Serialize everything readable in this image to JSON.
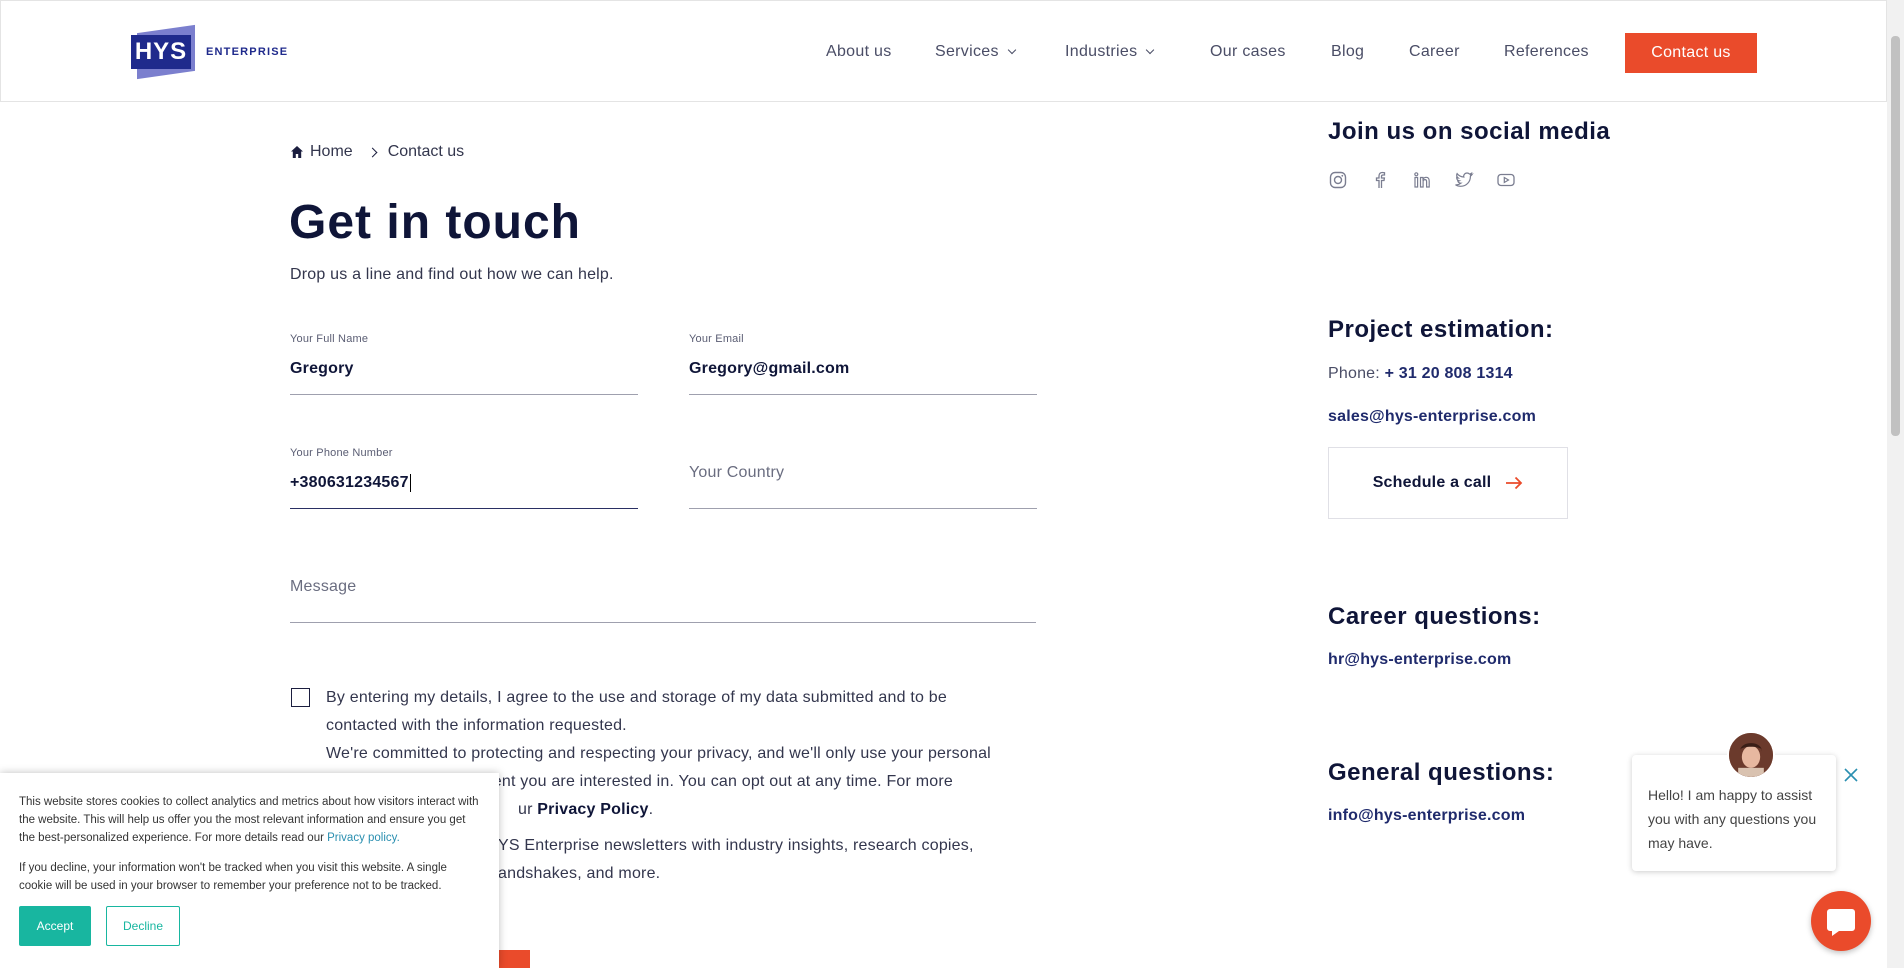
{
  "header": {
    "logo_mark": "HYS",
    "logo_text": "ENTERPRISE",
    "nav": [
      {
        "label": "About us"
      },
      {
        "label": "Services"
      },
      {
        "label": "Industries"
      },
      {
        "label": "Our cases"
      },
      {
        "label": "Blog"
      },
      {
        "label": "Career"
      },
      {
        "label": "References"
      }
    ],
    "cta_label": "Contact us"
  },
  "breadcrumb": {
    "home": "Home",
    "current": "Contact us"
  },
  "main": {
    "title": "Get in touch",
    "subtitle": "Drop us a line and find out how we can help."
  },
  "form": {
    "full_name": {
      "label": "Your Full Name",
      "value": "Gregory"
    },
    "email": {
      "label": "Your Email",
      "value": "Gregory@gmail.com"
    },
    "phone": {
      "label": "Your Phone Number",
      "value": "+380631234567"
    },
    "country": {
      "placeholder": "Your Country"
    },
    "message": {
      "placeholder": "Message"
    },
    "consent_line1": "By entering my details, I agree to the use and storage of my data submitted and to be",
    "consent_line2": "contacted with the information requested.",
    "consent_line3": "We're committed to protecting and respecting your privacy, and we'll only use your personal",
    "consent_line4_visible": "n content you are interested in. You can opt out at any time. For more",
    "consent_line5_visible": "ur",
    "privacy_link": "Privacy Policy",
    "newsletter_line1_visible": "YS Enterprise newsletters with industry insights, research copies,",
    "newsletter_line2_visible": "andshakes, and more."
  },
  "sidebar": {
    "social_title": "Join us on social media",
    "social_icons": [
      "instagram-icon",
      "facebook-icon",
      "linkedin-icon",
      "twitter-icon",
      "youtube-icon"
    ],
    "estimation_title": "Project estimation:",
    "phone_label": "Phone:",
    "phone_value": "+ 31 20 808 1314",
    "sales_email": "sales@hys-enterprise.com",
    "schedule_label": "Schedule a call",
    "career_title": "Career questions:",
    "career_email": "hr@hys-enterprise.com",
    "general_title": "General questions:",
    "general_email": "info@hys-enterprise.com"
  },
  "cookie": {
    "text1": "This website stores cookies to collect analytics and metrics about how visitors interact with the website. This will help us offer you the most relevant information and ensure you get the best-personalized experience. For more details read our",
    "privacy_link": "Privacy policy.",
    "text2": "If you decline, your information won't be tracked when you visit this website. A single cookie will be used in your browser to remember your preference not to be tracked.",
    "accept": "Accept",
    "decline": "Decline"
  },
  "chat": {
    "message": "Hello! I am happy to assist you with any questions you may have."
  },
  "colors": {
    "accent": "#ea4b2b",
    "navy": "#0f1538",
    "brand": "#1f2a8c",
    "cookie_accent": "#18b6a0"
  }
}
